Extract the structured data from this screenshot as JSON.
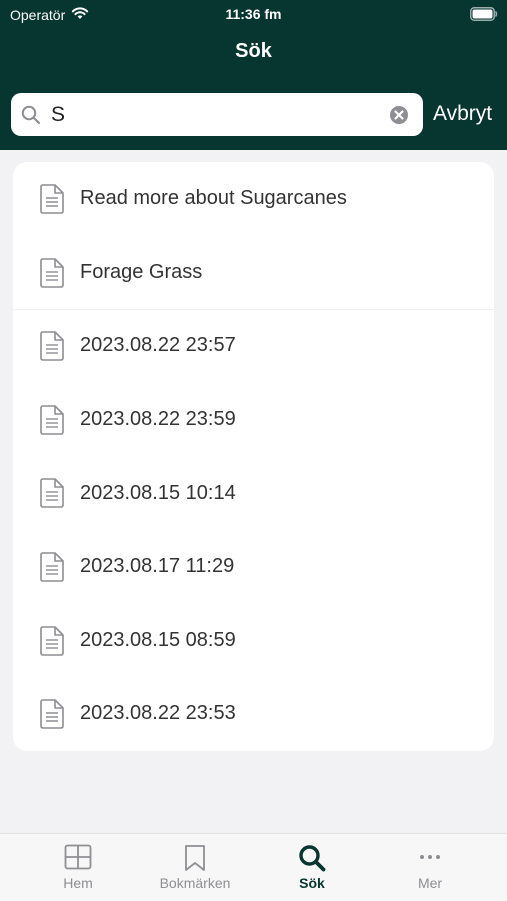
{
  "status_bar": {
    "carrier": "Operatör",
    "time": "11:36 fm"
  },
  "nav": {
    "title": "Sök"
  },
  "search": {
    "value": "S",
    "placeholder": "",
    "cancel_label": "Avbryt"
  },
  "results": [
    {
      "label": "Read more about Sugarcanes",
      "icon": "document-icon"
    },
    {
      "label": "Forage Grass",
      "icon": "document-icon"
    },
    {
      "label": "2023.08.22 23:57",
      "icon": "document-icon"
    },
    {
      "label": "2023.08.22 23:59",
      "icon": "document-icon"
    },
    {
      "label": "2023.08.15 10:14",
      "icon": "document-icon"
    },
    {
      "label": "2023.08.17 11:29",
      "icon": "document-icon"
    },
    {
      "label": "2023.08.15 08:59",
      "icon": "document-icon"
    },
    {
      "label": "2023.08.22 23:53",
      "icon": "document-icon"
    }
  ],
  "tabbar": {
    "tabs": [
      {
        "label": "Hem",
        "icon": "grid-icon",
        "active": false
      },
      {
        "label": "Bokmärken",
        "icon": "bookmark-icon",
        "active": false
      },
      {
        "label": "Sök",
        "icon": "search-icon",
        "active": true
      },
      {
        "label": "Mer",
        "icon": "more-icon",
        "active": false
      }
    ]
  },
  "colors": {
    "header_bg": "#07352f",
    "page_bg": "#f2f2f4",
    "active_tab": "#07352f",
    "inactive_tab": "#8e8e93"
  }
}
